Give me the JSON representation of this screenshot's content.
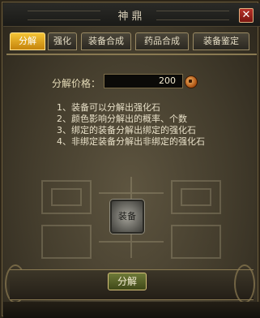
{
  "window": {
    "title": "神鼎",
    "close_label": "✕"
  },
  "tabs": [
    {
      "label": "分解",
      "active": true
    },
    {
      "label": "强化",
      "active": false
    },
    {
      "label": "装备合成",
      "active": false
    },
    {
      "label": "药品合成",
      "active": false
    },
    {
      "label": "装备鉴定",
      "active": false
    }
  ],
  "price": {
    "label": "分解价格：",
    "value": "200",
    "currency_icon": "coin-icon"
  },
  "instructions": [
    "1、装备可以分解出强化石",
    "2、颜色影响分解出的概率、个数",
    "3、绑定的装备分解出绑定的强化石",
    "4、非绑定装备分解出非绑定的强化石"
  ],
  "slot": {
    "label": "装备"
  },
  "actions": {
    "decompose_label": "分解"
  },
  "colors": {
    "active_tab": "#f0b830",
    "panel": "#4a4434",
    "button": "#5a6428"
  }
}
